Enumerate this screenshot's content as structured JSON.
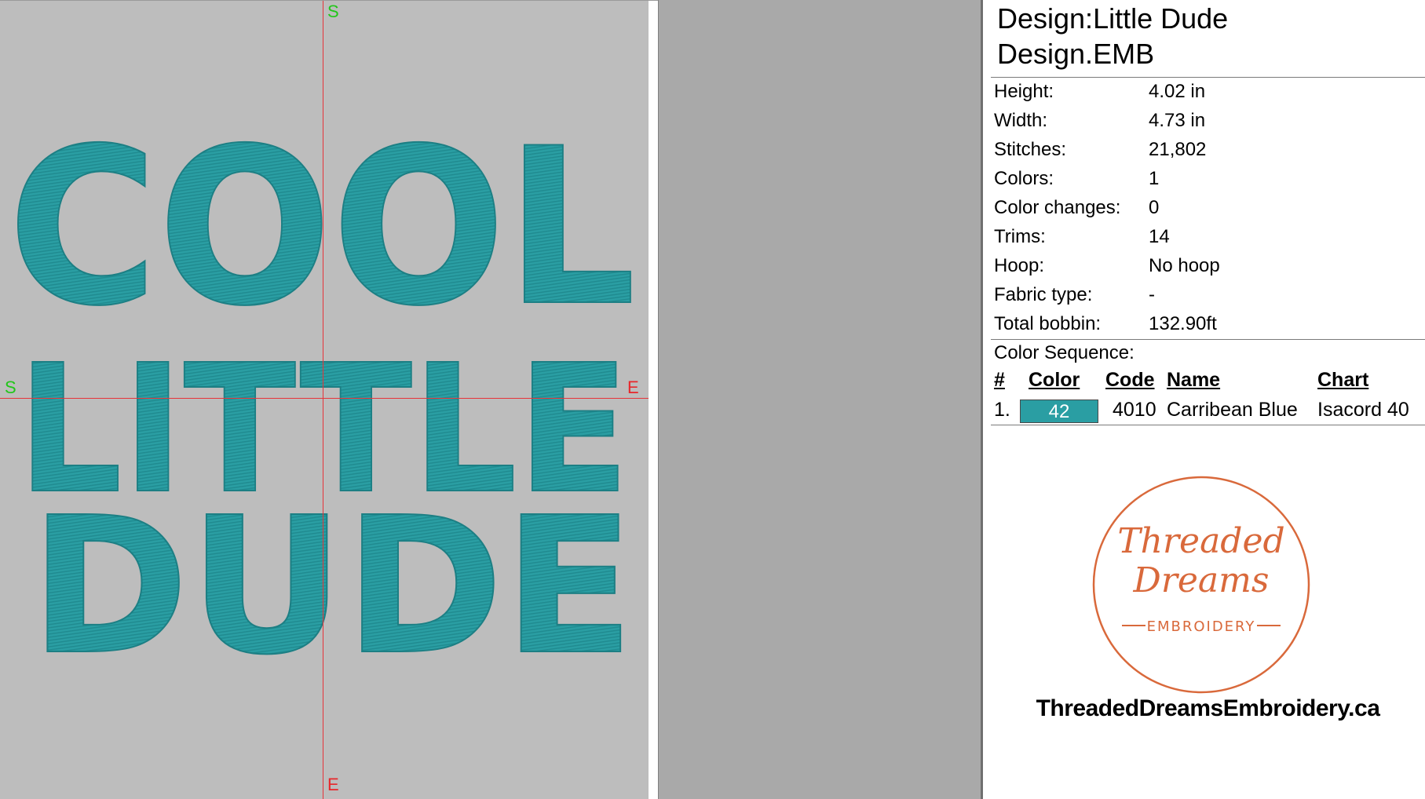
{
  "canvas": {
    "top_marker": "S",
    "bottom_marker": "E",
    "left_marker": "S",
    "right_marker": "E",
    "design_lines": [
      "COOL",
      "LITTLE",
      "DUDE"
    ],
    "thread_color": "#2a9ea3",
    "background": "#bdbdbd"
  },
  "info": {
    "title": "Design:Little Dude",
    "file": "Design.EMB",
    "stats": [
      {
        "label": "Height:",
        "value": "4.02 in"
      },
      {
        "label": "Width:",
        "value": "4.73 in"
      },
      {
        "label": "Stitches:",
        "value": "21,802"
      },
      {
        "label": "Colors:",
        "value": "1"
      },
      {
        "label": "Color changes:",
        "value": "0"
      },
      {
        "label": "Trims:",
        "value": "14"
      },
      {
        "label": "Hoop:",
        "value": "No hoop"
      },
      {
        "label": "Fabric type:",
        "value": "-"
      },
      {
        "label": "Total bobbin:",
        "value": "132.90ft"
      }
    ],
    "sequence_title": "Color Sequence:",
    "headers": {
      "num": "#",
      "color": "Color",
      "code": "Code",
      "name": "Name",
      "chart": "Chart"
    },
    "rows": [
      {
        "num": "1.",
        "color_num": "42",
        "swatch": "#2a9ea3",
        "code": "4010",
        "name": "Carribean Blue",
        "chart": "Isacord 40"
      }
    ],
    "logo_line1": "Threaded",
    "logo_line2": "Dreams",
    "logo_line3": "EMBROIDERY",
    "logo_color": "#d9693b",
    "website": "ThreadedDreamsEmbroidery.ca"
  }
}
